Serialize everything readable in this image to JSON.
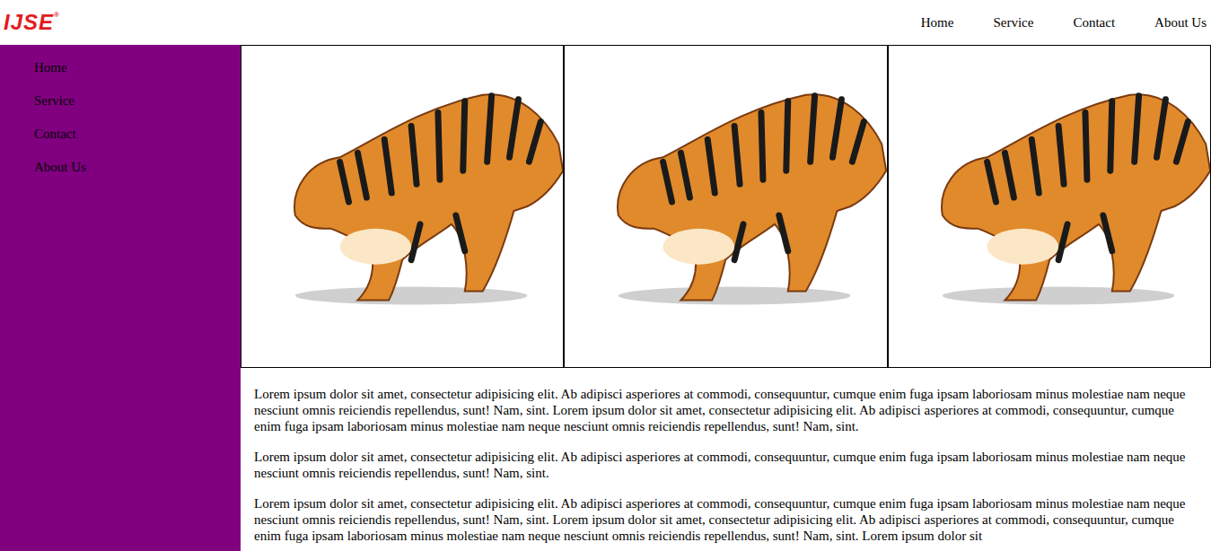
{
  "header": {
    "logo": "IJSE",
    "logo_mark": "®",
    "nav": [
      {
        "label": "Home"
      },
      {
        "label": "Service"
      },
      {
        "label": "Contact"
      },
      {
        "label": "About Us"
      }
    ]
  },
  "sidebar": {
    "items": [
      {
        "label": "Home"
      },
      {
        "label": "Service"
      },
      {
        "label": "Contact"
      },
      {
        "label": "About Us"
      }
    ]
  },
  "gallery": {
    "images": [
      {
        "kind": "photo"
      },
      {
        "kind": "photo"
      },
      {
        "kind": "photo"
      }
    ]
  },
  "content": {
    "paragraphs": [
      "Lorem ipsum dolor sit amet, consectetur adipisicing elit. Ab adipisci asperiores at commodi, consequuntur, cumque enim fuga ipsam laboriosam minus molestiae nam neque nesciunt omnis reiciendis repellendus, sunt! Nam, sint. Lorem ipsum dolor sit amet, consectetur adipisicing elit. Ab adipisci asperiores at commodi, consequuntur, cumque enim fuga ipsam laboriosam minus molestiae nam neque nesciunt omnis reiciendis repellendus, sunt! Nam, sint.",
      "Lorem ipsum dolor sit amet, consectetur adipisicing elit. Ab adipisci asperiores at commodi, consequuntur, cumque enim fuga ipsam laboriosam minus molestiae nam neque nesciunt omnis reiciendis repellendus, sunt! Nam, sint.",
      "Lorem ipsum dolor sit amet, consectetur adipisicing elit. Ab adipisci asperiores at commodi, consequuntur, cumque enim fuga ipsam laboriosam minus molestiae nam neque nesciunt omnis reiciendis repellendus, sunt! Nam, sint. Lorem ipsum dolor sit amet, consectetur adipisicing elit. Ab adipisci asperiores at commodi, consequuntur, cumque enim fuga ipsam laboriosam minus molestiae nam neque nesciunt omnis reiciendis repellendus, sunt! Nam, sint. Lorem ipsum dolor sit"
    ]
  }
}
